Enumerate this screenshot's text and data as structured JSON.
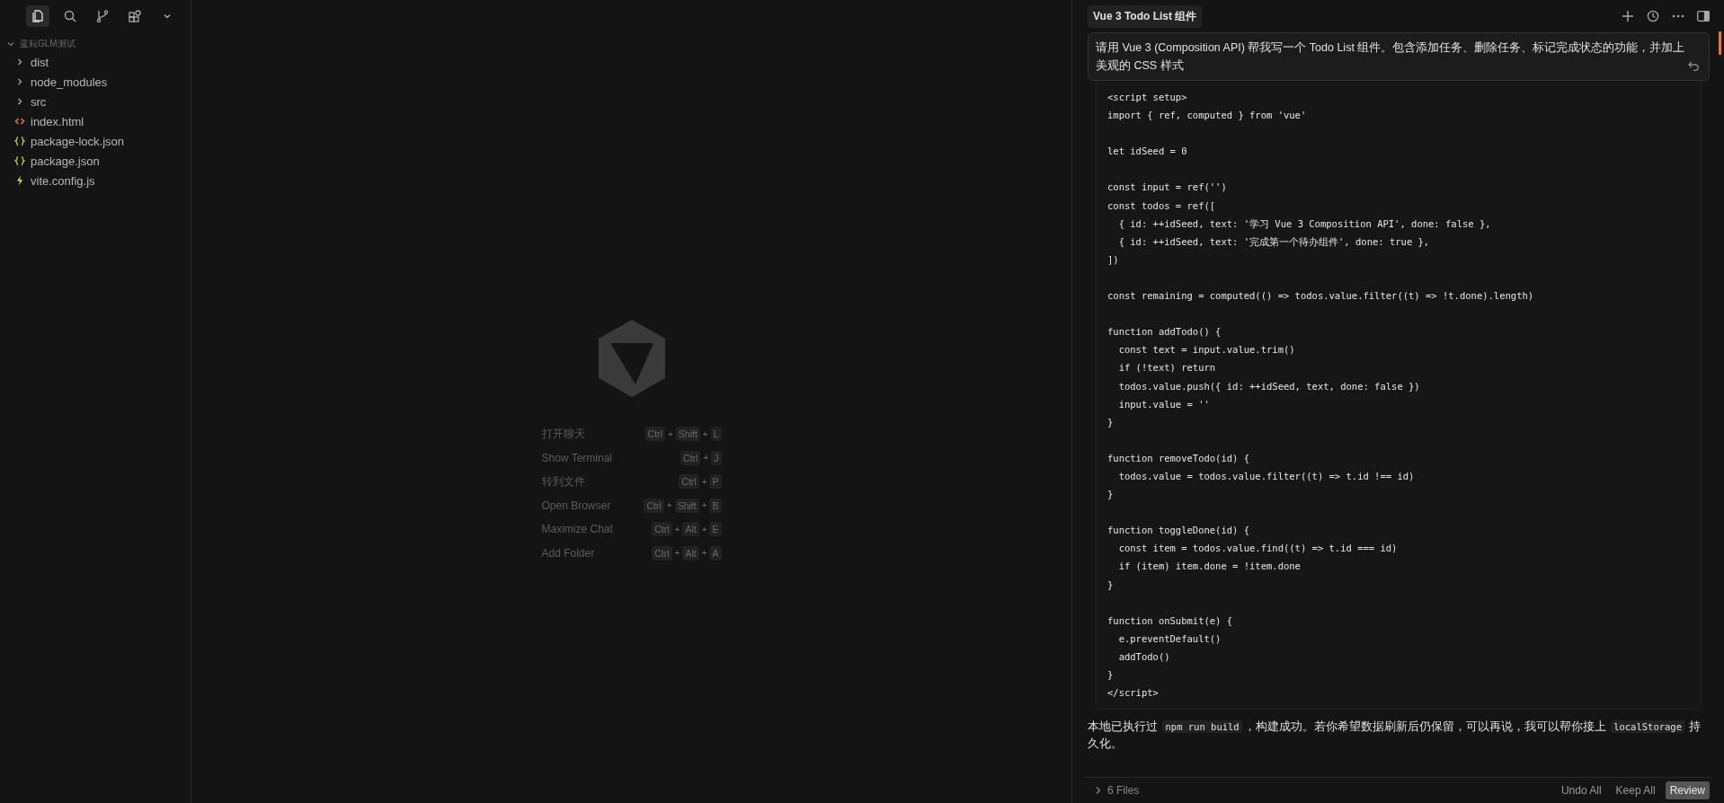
{
  "activity_bar": [
    {
      "kind": "files",
      "selected": true
    },
    {
      "kind": "search",
      "selected": false
    },
    {
      "kind": "branch",
      "selected": false
    },
    {
      "kind": "extensions",
      "selected": false
    },
    {
      "kind": "chevron",
      "selected": false
    }
  ],
  "explorer": {
    "root": {
      "label": "蓝耘GLM测试",
      "expanded": true,
      "children": [
        {
          "label": "dist",
          "kind": "folder",
          "expanded": false
        },
        {
          "label": "node_modules",
          "kind": "folder",
          "expanded": false
        },
        {
          "label": "src",
          "kind": "folder",
          "expanded": false
        },
        {
          "label": "index.html",
          "kind": "html"
        },
        {
          "label": "package-lock.json",
          "kind": "json"
        },
        {
          "label": "package.json",
          "kind": "json"
        },
        {
          "label": "vite.config.js",
          "kind": "js"
        }
      ]
    }
  },
  "shortcuts": [
    {
      "label": "打开聊天",
      "keys": [
        "Ctrl",
        "Shift",
        "L"
      ]
    },
    {
      "label": "Show Terminal",
      "keys": [
        "Ctrl",
        "J"
      ]
    },
    {
      "label": "转到文件",
      "keys": [
        "Ctrl",
        "P"
      ]
    },
    {
      "label": "Open Browser",
      "keys": [
        "Ctrl",
        "Shift",
        "B"
      ]
    },
    {
      "label": "Maximize Chat",
      "keys": [
        "Ctrl",
        "Alt",
        "E"
      ]
    },
    {
      "label": "Add Folder",
      "keys": [
        "Ctrl",
        "Alt",
        "A"
      ]
    }
  ],
  "shortcut_joiner": "+",
  "chat": {
    "tab": "Vue 3 Todo List 组件",
    "prompt": "请用 Vue 3 (Composition API) 帮我写一个 Todo List 组件。包含添加任务、删除任务、标记完成状态的功能，并加上美观的 CSS 样式",
    "code": "<script setup>\nimport { ref, computed } from 'vue'\n\nlet idSeed = 0\n\nconst input = ref('')\nconst todos = ref([\n  { id: ++idSeed, text: '学习 Vue 3 Composition API', done: false },\n  { id: ++idSeed, text: '完成第一个待办组件', done: true },\n])\n\nconst remaining = computed(() => todos.value.filter((t) => !t.done).length)\n\nfunction addTodo() {\n  const text = input.value.trim()\n  if (!text) return\n  todos.value.push({ id: ++idSeed, text, done: false })\n  input.value = ''\n}\n\nfunction removeTodo(id) {\n  todos.value = todos.value.filter((t) => t.id !== id)\n}\n\nfunction toggleDone(id) {\n  const item = todos.value.find((t) => t.id === id)\n  if (item) item.done = !item.done\n}\n\nfunction onSubmit(e) {\n  e.preventDefault()\n  addTodo()\n}\n</script>",
    "reply": [
      {
        "kind": "text",
        "text": "本地已执行过 "
      },
      {
        "kind": "code",
        "text": "npm run build"
      },
      {
        "kind": "text",
        "text": "，构建成功。若你希望数据刷新后仍保留，可以再说，我可以帮你接上 "
      },
      {
        "kind": "code",
        "text": "localStorage"
      },
      {
        "kind": "text",
        "text": " 持久化。"
      }
    ],
    "files": "6 Files",
    "actions": [
      {
        "label": "Undo All",
        "primary": false
      },
      {
        "label": "Keep All",
        "primary": false
      },
      {
        "label": "Review",
        "primary": true
      }
    ]
  }
}
